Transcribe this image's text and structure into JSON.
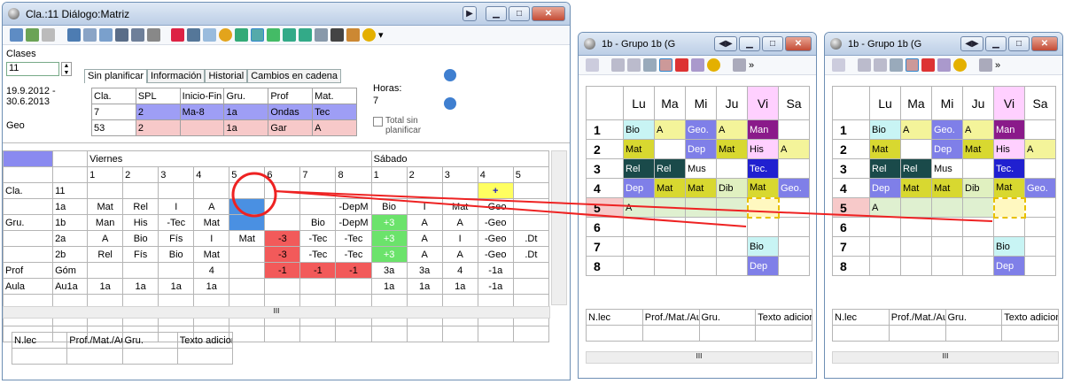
{
  "main": {
    "title": "Cla.:11 Diálogo:Matriz",
    "side": {
      "clases_label": "Clases",
      "clase_val": "11",
      "dates": "19.9.2012 -\n30.6.2013",
      "geo": "Geo"
    },
    "tabs": [
      "Sin planificar",
      "Información",
      "Historial",
      "Cambios en cadena"
    ],
    "unplanned": {
      "headers": [
        "Cla.",
        "SPL",
        "Inicio-Fin",
        "Gru.",
        "Prof",
        "Mat."
      ],
      "rows": [
        [
          "7",
          "2",
          "Ma-8",
          "1a",
          "Ondas",
          "Tec"
        ],
        [
          "53",
          "2",
          "",
          "1a",
          "Gar",
          "A"
        ]
      ]
    },
    "horas_label": "Horas:",
    "horas_val": "7",
    "total_label": "Total sin planificar",
    "days": [
      "Viernes",
      "Sábado"
    ],
    "periods": [
      "1",
      "2",
      "3",
      "4",
      "5",
      "6",
      "7",
      "8",
      "1",
      "2",
      "3",
      "4",
      "5"
    ],
    "rows": [
      {
        "a": "Cla.",
        "b": "11",
        "c": [
          "",
          "",
          "",
          "",
          "",
          "",
          "",
          "",
          "",
          "",
          "",
          "+",
          ""
        ]
      },
      {
        "a": "",
        "b": "1a",
        "c": [
          "Mat",
          "Rel",
          "I",
          "A",
          "",
          "",
          "",
          "-DepM",
          "Bio",
          "I",
          "Mat",
          "-Geo",
          ""
        ]
      },
      {
        "a": "Gru.",
        "b": "1b",
        "c": [
          "Man",
          "His",
          "-Tec",
          "Mat",
          "",
          "",
          "Bio",
          "-DepM",
          "+3",
          "A",
          "A",
          "-Geo",
          ""
        ]
      },
      {
        "a": "",
        "b": "2a",
        "c": [
          "A",
          "Bio",
          "Fís",
          "I",
          "Mat",
          "-3",
          "-Tec",
          "-Tec",
          "+3",
          "A",
          "I",
          "-Geo",
          ".Dt"
        ]
      },
      {
        "a": "",
        "b": "2b",
        "c": [
          "Rel",
          "Fís",
          "Bio",
          "Mat",
          "",
          "-3",
          "-Tec",
          "-Tec",
          "+3",
          "A",
          "A",
          "-Geo",
          ".Dt"
        ]
      },
      {
        "a": "Prof",
        "b": "Góm",
        "c": [
          "",
          "",
          "",
          "4",
          "",
          "-1",
          "-1",
          "-1",
          "3a",
          "3a",
          "4",
          "-1a",
          ""
        ]
      },
      {
        "a": "Aula",
        "b": "Au1a",
        "c": [
          "1a",
          "1a",
          "1a",
          "1a",
          "",
          "",
          "",
          "",
          "1a",
          "1a",
          "1a",
          "-1a",
          ""
        ]
      }
    ],
    "bottom_headers": [
      "N.lec",
      "Prof./Mat./Aula",
      "Gru.",
      "Texto adicional"
    ],
    "scroll_dots": "III"
  },
  "schedules": [
    {
      "title": "1b - Grupo 1b (G",
      "days": [
        "Lu",
        "Ma",
        "Mi",
        "Ju",
        "Vi",
        "Sa"
      ],
      "grid": [
        [
          "Bio",
          "A",
          "Geo.",
          "A",
          "Man",
          ""
        ],
        [
          "Mat",
          "",
          "Dep",
          "Mat",
          "His",
          "A"
        ],
        [
          "Rel",
          "Rel",
          "Mus",
          "",
          "Tec.",
          ""
        ],
        [
          "Dep",
          "Mat",
          "Mat",
          "Dib",
          "Mat",
          "Geo."
        ],
        [
          "A",
          "",
          "",
          "",
          "",
          ""
        ],
        [
          "",
          "",
          "",
          "",
          "",
          ""
        ],
        [
          "",
          "",
          "",
          "",
          "Bio",
          ""
        ],
        [
          "",
          "",
          "",
          "",
          "Dep",
          ""
        ]
      ]
    },
    {
      "title": "1b - Grupo 1b (G",
      "days": [
        "Lu",
        "Ma",
        "Mi",
        "Ju",
        "Vi",
        "Sa"
      ],
      "grid": [
        [
          "Bio",
          "A",
          "Geo.",
          "A",
          "Man",
          ""
        ],
        [
          "Mat",
          "",
          "Dep",
          "Mat",
          "His",
          "A"
        ],
        [
          "Rel",
          "Rel",
          "Mus",
          "",
          "Tec.",
          ""
        ],
        [
          "Dep",
          "Mat",
          "Mat",
          "Dib",
          "Mat",
          "Geo."
        ],
        [
          "A",
          "",
          "",
          "",
          "",
          ""
        ],
        [
          "",
          "",
          "",
          "",
          "",
          ""
        ],
        [
          "",
          "",
          "",
          "",
          "Bio",
          ""
        ],
        [
          "",
          "",
          "",
          "",
          "Dep",
          ""
        ]
      ]
    }
  ],
  "sched_rows": [
    "1",
    "2",
    "3",
    "4",
    "5",
    "6",
    "7",
    "8"
  ],
  "sched_bottom": [
    "N.lec",
    "Prof./Mat./Aula",
    "Gru.",
    "Texto adicior"
  ],
  "colors": {
    "purple": "#9e9ef5",
    "pink": "#f7c9c9",
    "green": "#6be36b",
    "red": "#f25a5a",
    "yellow": "#ffff60",
    "blue": "#4a90e2"
  }
}
